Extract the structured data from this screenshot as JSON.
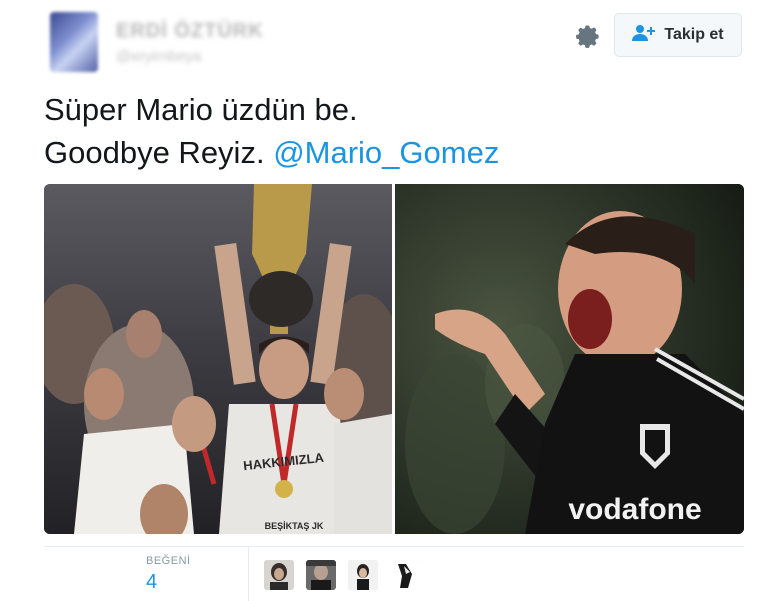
{
  "tweet": {
    "author_name": "ERDİ ÖZTÜRK",
    "author_handle": "@eryirnbeya",
    "follow_button_label": "Takip et",
    "text_line1": "Süper Mario üzdün be.",
    "text_line2_prefix": "Goodbye Reyiz.",
    "mention": "@Mario_Gomez",
    "likes_label": "BEĞENİ",
    "likes_count": "4",
    "likers_count": 4
  },
  "photo_right": {
    "jersey_sponsor": "vodafone"
  },
  "photo_left": {
    "shirt_text": "HAKKIMIZLA",
    "shirt_text_sub": "BEŞİKTAŞ JK"
  },
  "colors": {
    "link": "#1b95e0",
    "text": "#14171a",
    "muted": "#8899a6",
    "border": "#e6ecf0"
  },
  "icons": [
    "gear-icon",
    "add-user-icon"
  ]
}
